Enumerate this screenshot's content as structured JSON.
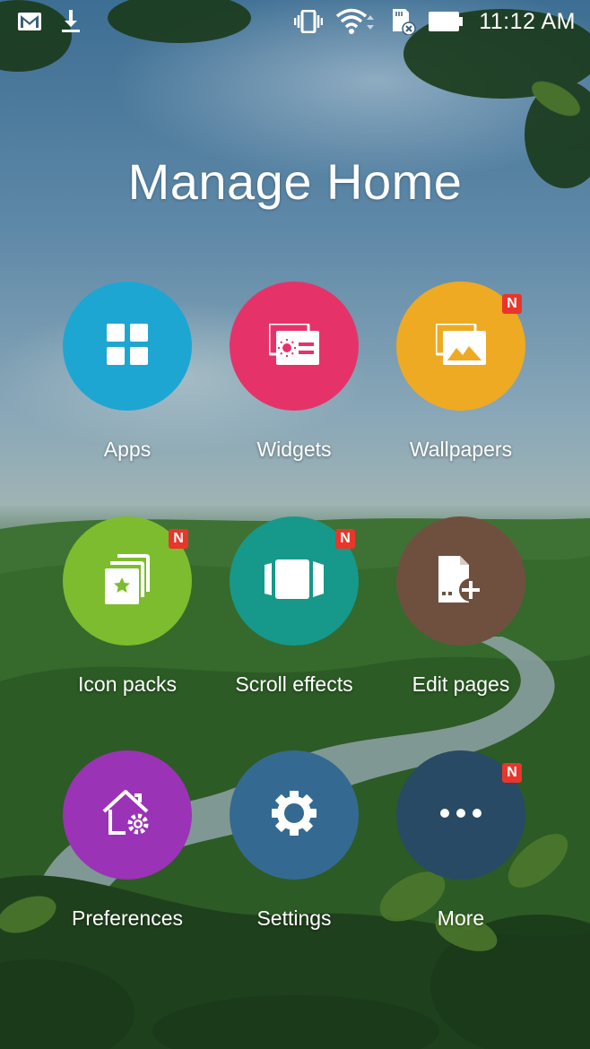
{
  "status_bar": {
    "time": "11:12 AM",
    "icons_left": [
      "gmail-icon",
      "download-icon"
    ],
    "icons_right": [
      "vibrate-icon",
      "wifi-icon",
      "sd-card-icon",
      "battery-icon"
    ]
  },
  "page_title": "Manage Home",
  "badge_text": "N",
  "tiles": [
    {
      "label": "Apps",
      "icon": "apps-grid-icon",
      "color": "#1ea6d3",
      "badge": false
    },
    {
      "label": "Widgets",
      "icon": "widgets-icon",
      "color": "#e5336a",
      "badge": false
    },
    {
      "label": "Wallpapers",
      "icon": "wallpapers-icon",
      "color": "#eeaa23",
      "badge": true
    },
    {
      "label": "Icon packs",
      "icon": "icon-packs-icon",
      "color": "#7dbc2e",
      "badge": true
    },
    {
      "label": "Scroll effects",
      "icon": "scroll-effects-icon",
      "color": "#16998a",
      "badge": true
    },
    {
      "label": "Edit pages",
      "icon": "edit-pages-icon",
      "color": "#6f503f",
      "badge": false
    },
    {
      "label": "Preferences",
      "icon": "preferences-icon",
      "color": "#9a33b6",
      "badge": false
    },
    {
      "label": "Settings",
      "icon": "settings-gear-icon",
      "color": "#346a92",
      "badge": false
    },
    {
      "label": "More",
      "icon": "more-dots-icon",
      "color": "#284a64",
      "badge": true
    }
  ]
}
